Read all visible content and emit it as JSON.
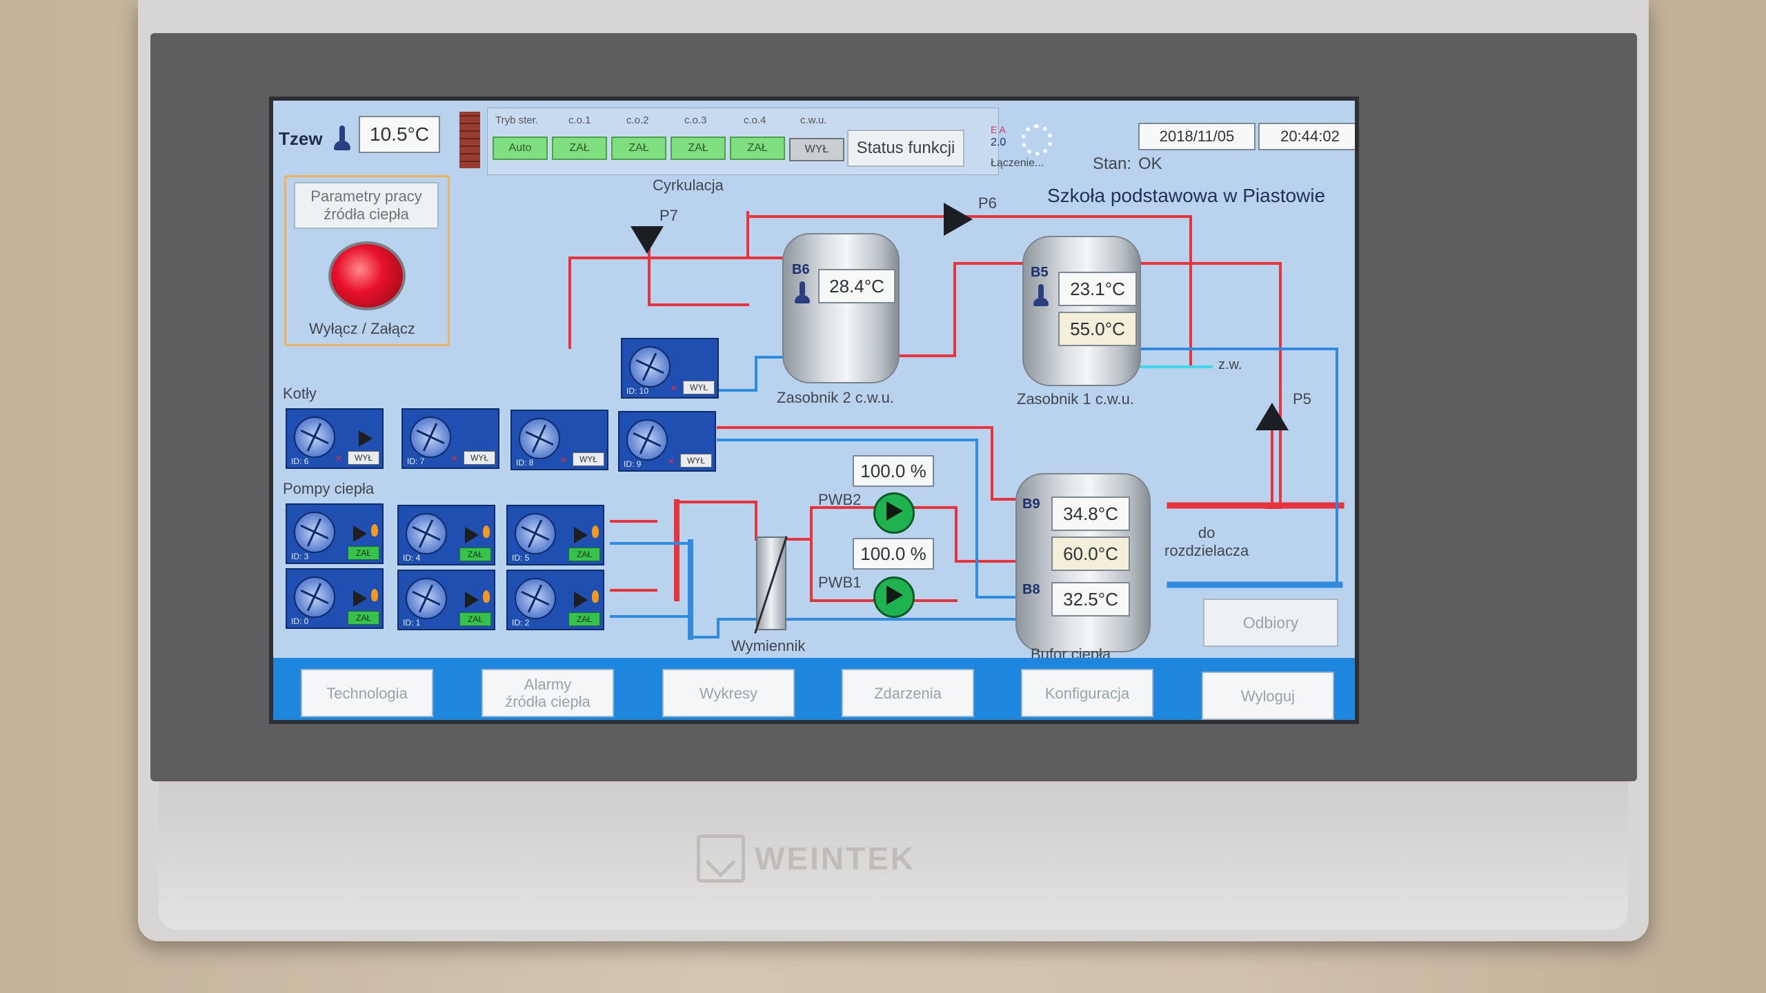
{
  "header": {
    "tzew_label": "Tzew",
    "tzew_value": "10.5°C",
    "mode_headers": [
      "Tryb ster.",
      "c.o.1",
      "c.o.2",
      "c.o.3",
      "c.o.4",
      "c.w.u."
    ],
    "mode_values": [
      "Auto",
      "ZAŁ",
      "ZAŁ",
      "ZAŁ",
      "ZAŁ",
      "WYŁ"
    ],
    "status_button": "Status funkcji",
    "connection_label": "Łączenie...",
    "ea_label": "E A",
    "version": "2.0",
    "date": "2018/11/05",
    "time": "20:44:02",
    "stan_label": "Stan:",
    "stan_value": "OK"
  },
  "title": "Szkoła podstawowa w Piastowie",
  "source_panel": {
    "button": "Parametry pracy\nźródła ciepła",
    "toggle_label": "Wyłącz / Załącz"
  },
  "labels": {
    "cyrkulacja": "Cyrkulacja",
    "p7": "P7",
    "p6": "P6",
    "p5": "P5",
    "zw": "z.w.",
    "kotly": "Kotły",
    "pompy": "Pompy ciepła",
    "pwb2": "PWB2",
    "pwb1": "PWB1",
    "wymiennik": "Wymiennik",
    "do_rozdzielacza": "do\nrozdzielacza"
  },
  "tanks": {
    "zasobnik2": {
      "label": "Zasobnik 2 c.w.u.",
      "sensor": "B6",
      "temp": "28.4°C"
    },
    "zasobnik1": {
      "label": "Zasobnik 1 c.w.u.",
      "sensor": "B5",
      "temp": "23.1°C",
      "setpoint": "55.0°C"
    },
    "bufor": {
      "label": "Bufor ciepła",
      "sensor_top": "B9",
      "temp_top": "34.8°C",
      "setpoint": "60.0°C",
      "sensor_bottom": "B8",
      "temp_bottom": "32.5°C"
    }
  },
  "pumps": {
    "pwb2_value": "100.0 %",
    "pwb1_value": "100.0 %"
  },
  "units": {
    "circulation": {
      "id": "ID: 10",
      "state": "WYŁ"
    },
    "boilers": [
      {
        "id": "ID: 6",
        "state": "WYŁ"
      },
      {
        "id": "ID: 7",
        "state": "WYŁ"
      },
      {
        "id": "ID: 8",
        "state": "WYŁ"
      },
      {
        "id": "ID: 9",
        "state": "WYŁ"
      }
    ],
    "heat_pumps_top": [
      {
        "id": "ID: 3",
        "state": "ZAŁ"
      },
      {
        "id": "ID: 4",
        "state": "ZAŁ"
      },
      {
        "id": "ID: 5",
        "state": "ZAŁ"
      }
    ],
    "heat_pumps_bottom": [
      {
        "id": "ID: 0",
        "state": "ZAŁ"
      },
      {
        "id": "ID: 1",
        "state": "ZAŁ"
      },
      {
        "id": "ID: 2",
        "state": "ZAŁ"
      }
    ]
  },
  "odbiory": "Odbiory",
  "nav": [
    "Technologia",
    "Alarmy\nźródła ciepła",
    "Wykresy",
    "Zdarzenia",
    "Konfiguracja",
    "Wyloguj"
  ],
  "brand": "WEINTEK",
  "colors": {
    "hot_pipe": "#e8323c",
    "cold_pipe": "#2f8be0",
    "screen_bg": "#b9d3ee",
    "nav_bg": "#1f86de",
    "on_green": "#37c24b"
  }
}
